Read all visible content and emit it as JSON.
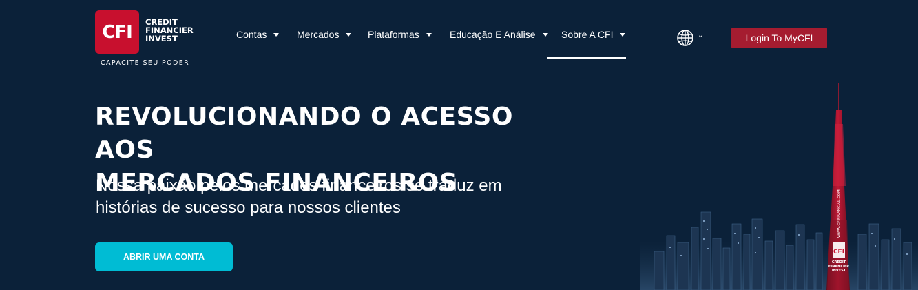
{
  "logo": {
    "mark": "CFI",
    "words": [
      "CREDIT",
      "FINANCIER",
      "INVEST"
    ],
    "tagline": "CAPACITE SEU PODER"
  },
  "nav": {
    "items": [
      {
        "label": "Contas"
      },
      {
        "label": "Mercados"
      },
      {
        "label": "Plataformas"
      },
      {
        "label": "Educação E Análise"
      },
      {
        "label": "Sobre A CFI",
        "active": true
      }
    ]
  },
  "header": {
    "language_icon": "globe-icon",
    "login_label": "Login To MyCFI"
  },
  "hero": {
    "title_line1": "REVOLUCIONANDO O ACESSO AOS",
    "title_line2": "MERCADOS FINANCEIROS",
    "subtitle_line1": "Nossa paixão pelos mercados financeiros se traduz em",
    "subtitle_line2": "histórias de sucesso para nossos clientes",
    "cta_label": "ABRIR UMA CONTA"
  },
  "tower": {
    "vertical_text": "WWW.CFIFINANCIAL.COM",
    "badge": "CFI",
    "badge_words": [
      "CREDIT",
      "FINANCIER",
      "INVEST"
    ]
  },
  "colors": {
    "background": "#0b2139",
    "brand_red": "#c8102e",
    "login_bg": "#a51c30",
    "cta_bg": "#00bcd4"
  }
}
